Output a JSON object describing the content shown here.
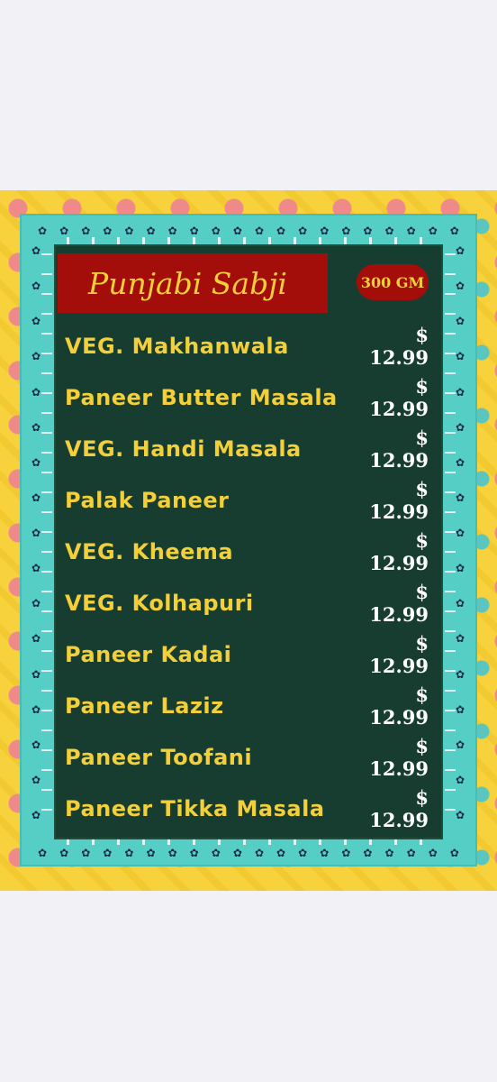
{
  "menu": {
    "title": "Punjabi Sabji",
    "weight_badge": "300 GM",
    "items": [
      {
        "name": "VEG. Makhanwala",
        "price": "$ 12.99"
      },
      {
        "name": "Paneer Butter Masala",
        "price": "$ 12.99"
      },
      {
        "name": "VEG. Handi Masala",
        "price": "$ 12.99"
      },
      {
        "name": "Palak Paneer",
        "price": "$ 12.99"
      },
      {
        "name": "VEG. Kheema",
        "price": "$ 12.99"
      },
      {
        "name": "VEG. Kolhapuri",
        "price": "$ 12.99"
      },
      {
        "name": "Paneer Kadai",
        "price": "$ 12.99"
      },
      {
        "name": "Paneer Laziz",
        "price": "$ 12.99"
      },
      {
        "name": "Paneer Toofani",
        "price": "$ 12.99"
      },
      {
        "name": "Paneer Tikka Masala",
        "price": "$ 12.99"
      }
    ]
  },
  "colors": {
    "board": "#173d30",
    "title_bg": "#a30d0a",
    "accent_text": "#f3cf3a",
    "price_text": "#ffffff",
    "frame_teal": "#55cfc6",
    "frame_yellow": "#f7d23c"
  }
}
